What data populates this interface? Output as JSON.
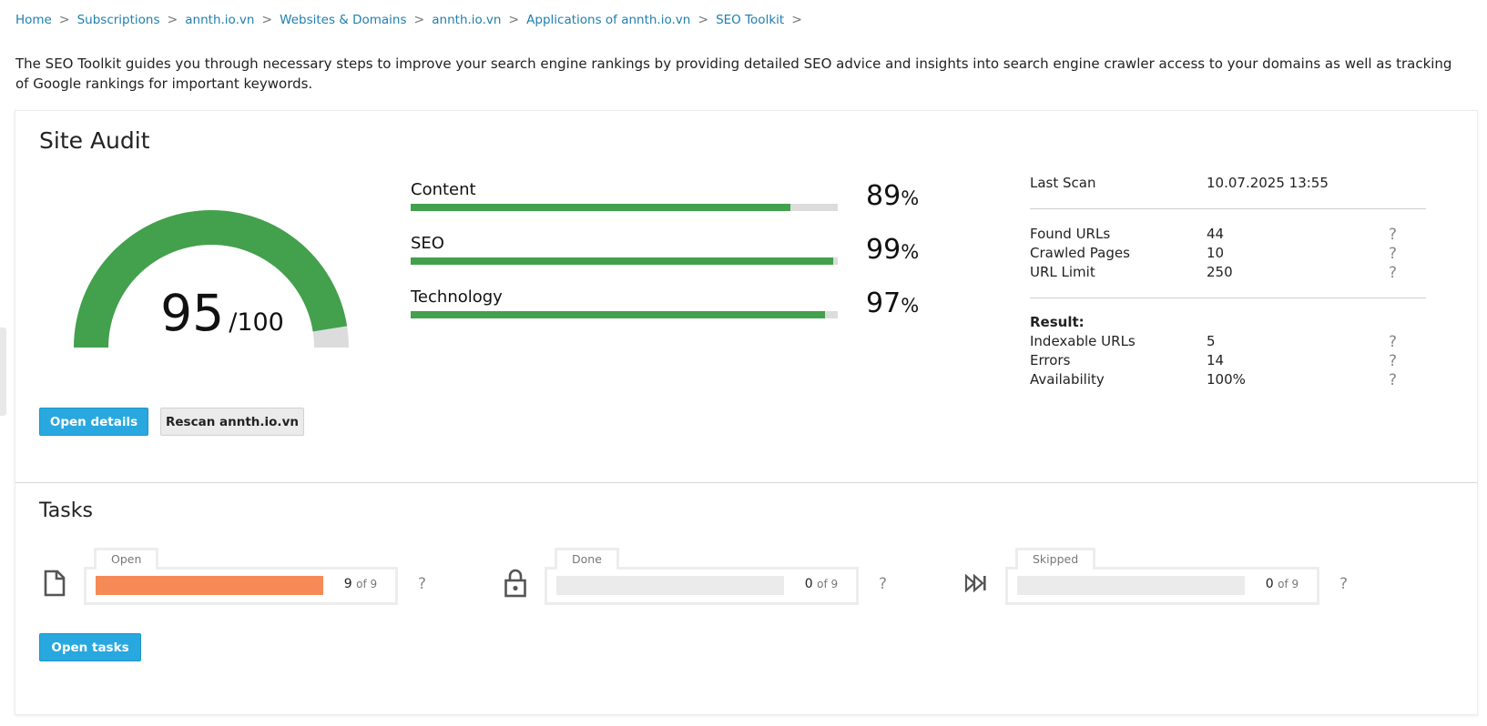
{
  "breadcrumb": [
    {
      "label": "Home"
    },
    {
      "label": "Subscriptions"
    },
    {
      "label": "annth.io.vn"
    },
    {
      "label": "Websites & Domains"
    },
    {
      "label": "annth.io.vn"
    },
    {
      "label": "Applications of annth.io.vn"
    },
    {
      "label": "SEO Toolkit"
    }
  ],
  "breadcrumb_separator": ">",
  "intro": "The SEO Toolkit guides you through necessary steps to improve your search engine rankings by providing detailed SEO advice and insights into search engine crawler access to your domains as well as tracking of Google rankings for important keywords.",
  "site_audit": {
    "title": "Site Audit",
    "score": "95",
    "score_max": "/100",
    "score_value": 95,
    "metrics": [
      {
        "label": "Content",
        "value": 89,
        "value_text": "89",
        "unit": "%"
      },
      {
        "label": "SEO",
        "value": 99,
        "value_text": "99",
        "unit": "%"
      },
      {
        "label": "Technology",
        "value": 97,
        "value_text": "97",
        "unit": "%"
      }
    ],
    "last_scan_label": "Last Scan",
    "last_scan_value": "10.07.2025 13:55",
    "stats": [
      {
        "label": "Found URLs",
        "value": "44",
        "help": "?"
      },
      {
        "label": "Crawled Pages",
        "value": "10",
        "help": "?"
      },
      {
        "label": "URL Limit",
        "value": "250",
        "help": "?"
      }
    ],
    "result_heading": "Result:",
    "results": [
      {
        "label": "Indexable URLs",
        "value": "5",
        "help": "?"
      },
      {
        "label": "Errors",
        "value": "14",
        "help": "?"
      },
      {
        "label": "Availability",
        "value": "100%",
        "help": "?"
      }
    ],
    "open_details_label": "Open details",
    "rescan_label": "Rescan annth.io.vn"
  },
  "tasks": {
    "title": "Tasks",
    "items": [
      {
        "label": "Open",
        "count": "9",
        "of": "of 9",
        "fraction": 1.0,
        "icon": "document-icon",
        "help": "?"
      },
      {
        "label": "Done",
        "count": "0",
        "of": "of 9",
        "fraction": 0.0,
        "icon": "lock-icon",
        "help": "?"
      },
      {
        "label": "Skipped",
        "count": "0",
        "of": "of 9",
        "fraction": 0.0,
        "icon": "skip-forward-icon",
        "help": "?"
      }
    ],
    "open_tasks_label": "Open tasks"
  },
  "colors": {
    "accent": "#28a8df",
    "link": "#1f7fae",
    "success": "#43a04c",
    "task_open": "#f68a56",
    "track": "#dcdcdc"
  }
}
